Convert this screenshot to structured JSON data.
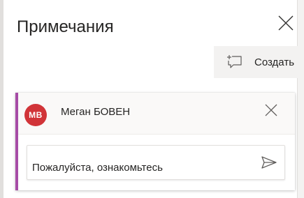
{
  "pane": {
    "title": "Примечания",
    "close_icon": "close-icon"
  },
  "toolbar": {
    "create_label": "Создать",
    "create_icon": "new-comment-icon"
  },
  "comment": {
    "avatar_initials": "MB",
    "avatar_color": "#d13438",
    "accent_color": "#a64ca6",
    "author": "Меган БОВЕН",
    "delete_icon": "close-icon",
    "reply_value": "Пожалуйста, ознакомьтесь",
    "send_icon": "send-icon"
  }
}
